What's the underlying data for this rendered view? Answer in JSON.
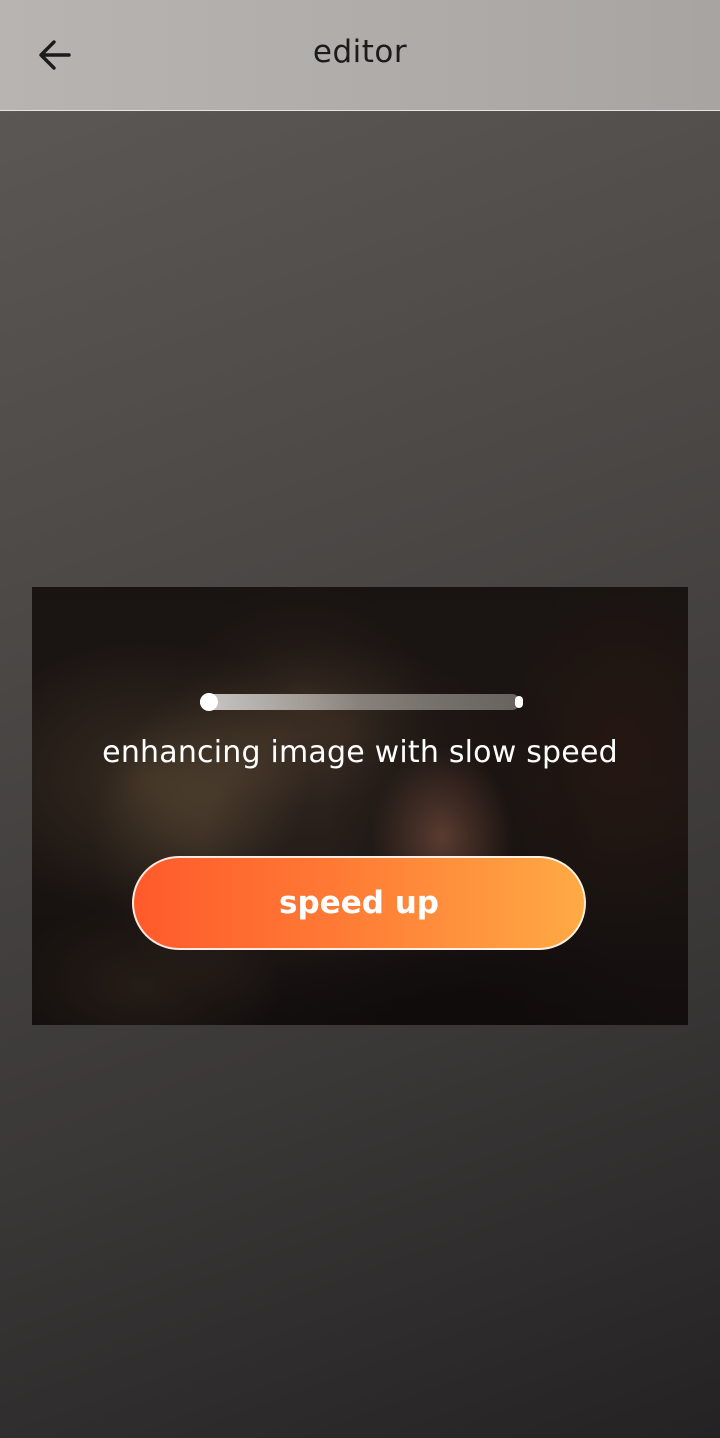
{
  "header": {
    "title": "editor",
    "back_icon": "arrow-left-icon"
  },
  "editor": {
    "progress": {
      "value": 0.0
    },
    "status_text": "enhancing image with slow speed",
    "speed_up_label": "speed up",
    "button_gradient": [
      "#ff5a2b",
      "#ffaa45"
    ]
  },
  "colors": {
    "header_bg": "#b2afac",
    "text_dark": "#1b1b1b",
    "text_light": "#ffffff"
  }
}
